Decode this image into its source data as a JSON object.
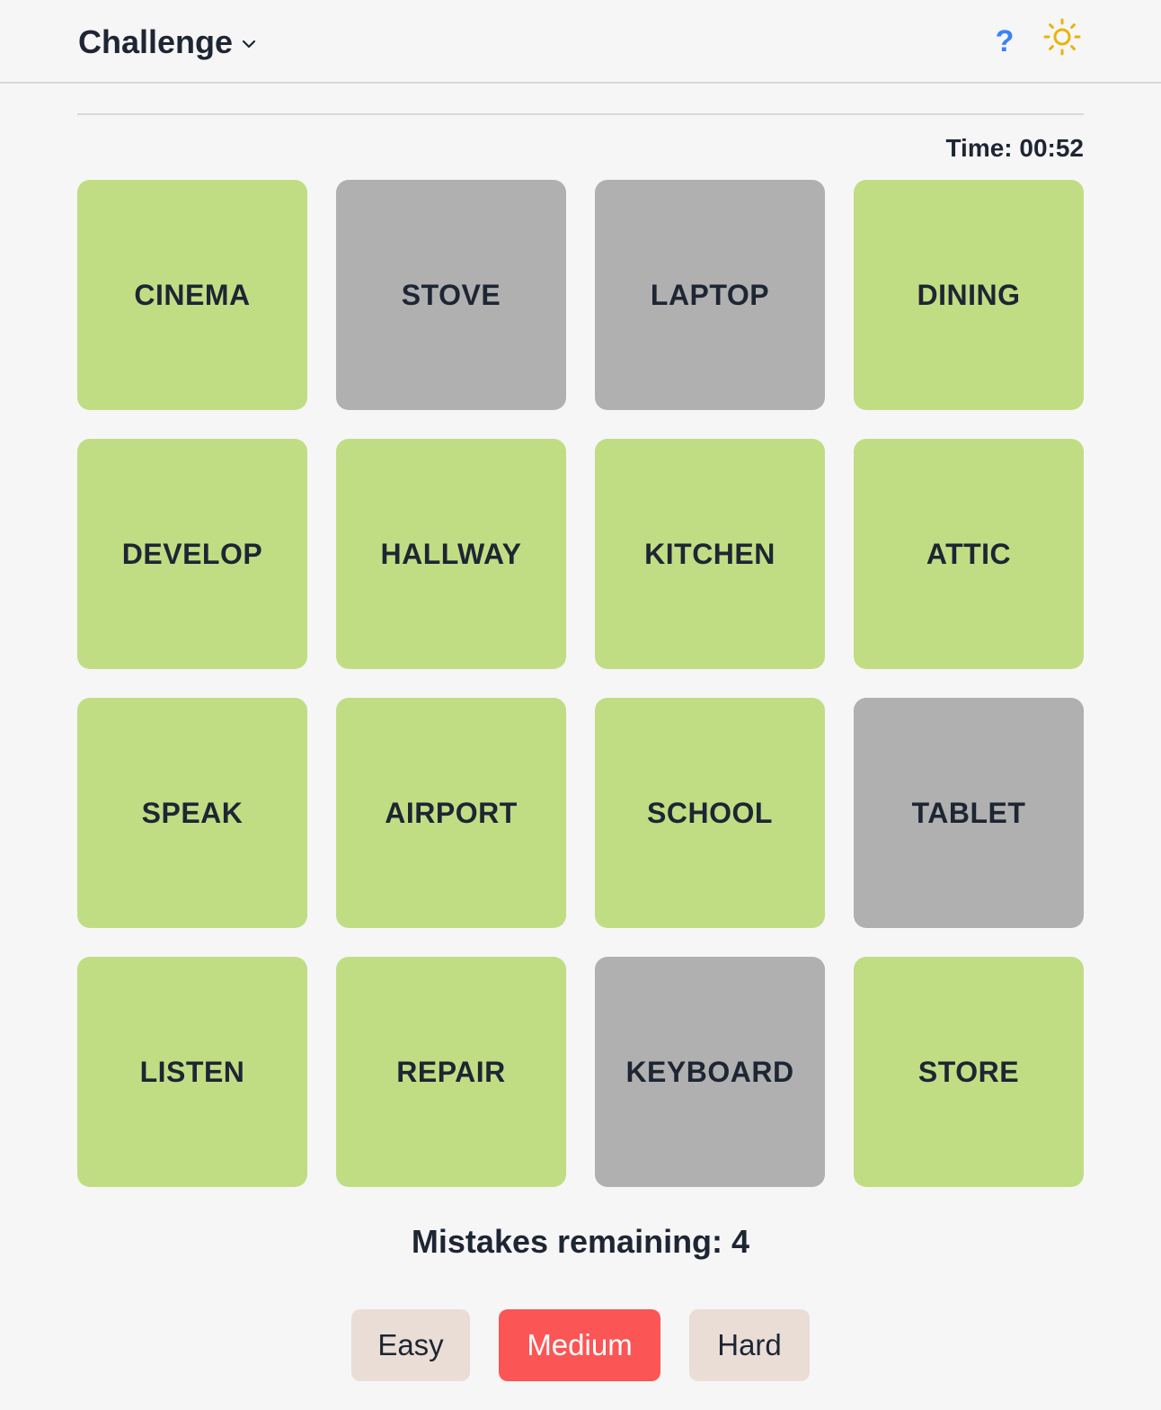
{
  "header": {
    "title": "Challenge",
    "help_label": "?"
  },
  "timer": {
    "text": "Time: 00:52"
  },
  "tiles": [
    {
      "label": "CINEMA",
      "state": "green"
    },
    {
      "label": "STOVE",
      "state": "gray"
    },
    {
      "label": "LAPTOP",
      "state": "gray"
    },
    {
      "label": "DINING",
      "state": "green"
    },
    {
      "label": "DEVELOP",
      "state": "green"
    },
    {
      "label": "HALLWAY",
      "state": "green"
    },
    {
      "label": "KITCHEN",
      "state": "green"
    },
    {
      "label": "ATTIC",
      "state": "green"
    },
    {
      "label": "SPEAK",
      "state": "green"
    },
    {
      "label": "AIRPORT",
      "state": "green"
    },
    {
      "label": "SCHOOL",
      "state": "green"
    },
    {
      "label": "TABLET",
      "state": "gray"
    },
    {
      "label": "LISTEN",
      "state": "green"
    },
    {
      "label": "REPAIR",
      "state": "green"
    },
    {
      "label": "KEYBOARD",
      "state": "gray"
    },
    {
      "label": "STORE",
      "state": "green"
    }
  ],
  "status": {
    "mistakes_text": "Mistakes remaining: 4"
  },
  "difficulty": {
    "easy_label": "Easy",
    "medium_label": "Medium",
    "hard_label": "Hard",
    "selected": "Medium"
  },
  "colors": {
    "tile_green": "#c0dd84",
    "tile_gray": "#b0b0b0",
    "selected_button": "#fb5555",
    "unselected_button": "#e9ddd5",
    "help_icon": "#3b82f6",
    "sun_icon": "#eab308"
  },
  "icons": {
    "dropdown": "chevron-down-icon",
    "help": "help-icon",
    "theme": "sun-icon"
  }
}
